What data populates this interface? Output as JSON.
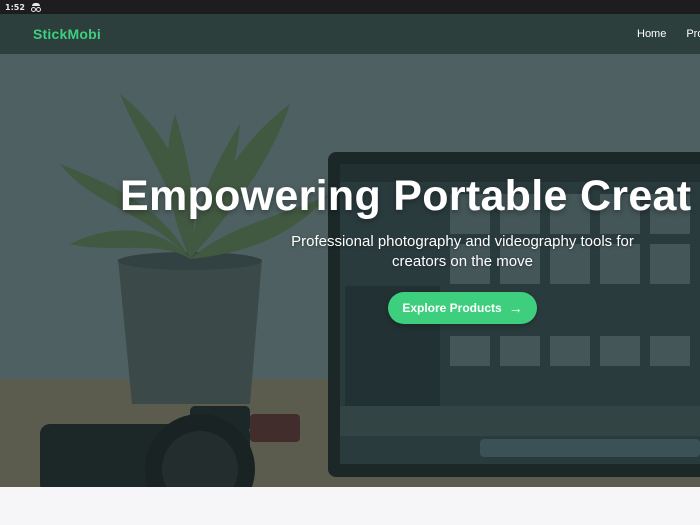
{
  "status_bar": {
    "time": "1:52",
    "icon": "incognito-icon"
  },
  "navbar": {
    "brand": "StickMobi",
    "links": [
      {
        "label": "Home"
      },
      {
        "label": "Pro"
      }
    ]
  },
  "hero": {
    "title": "Empowering Portable Creat",
    "subtitle": "Professional photography and videography tools for creators on the move",
    "cta_label": "Explore Products",
    "cta_icon": "arrow-right-icon",
    "background_description_icons": [
      "plant-icon",
      "laptop-icon",
      "camera-icon"
    ]
  },
  "colors": {
    "accent": "#3ecf7e",
    "navbar": "#2d3f3d",
    "status_bar": "#1d1d20",
    "overlay": "#1e302e"
  }
}
